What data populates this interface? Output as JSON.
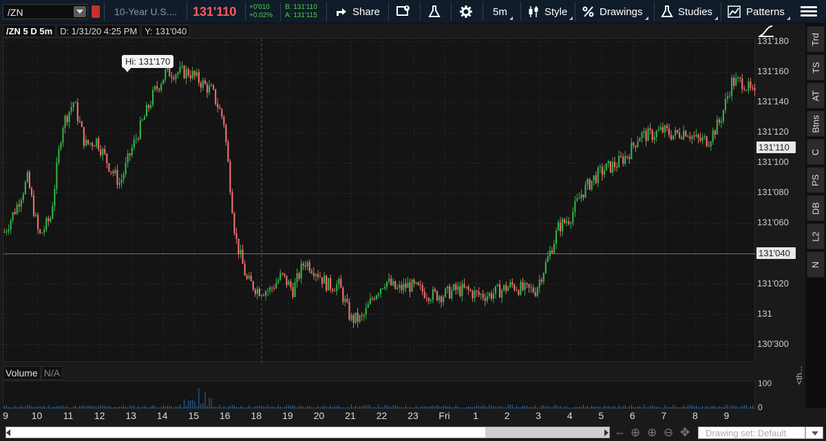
{
  "toolbar": {
    "symbol": "/ZN",
    "description": "10-Year U.S....",
    "last_price": "131'110",
    "net_change": "+0'010",
    "pct_change": "+0.02%",
    "bid": "B: 131'110",
    "ask": "A: 131'115",
    "share_label": "Share",
    "interval_label": "5m",
    "style_label": "Style",
    "drawings_label": "Drawings",
    "studies_label": "Studies",
    "patterns_label": "Patterns"
  },
  "chart_header": {
    "symbol_period": "/ZN 5 D 5m",
    "date_readout": "D: 1/31/20 4:25 PM",
    "price_readout": "Y: 131'040"
  },
  "hi_label": "Hi: 131'170",
  "price_axis": {
    "ticks": [
      "131'180",
      "131'160",
      "131'140",
      "131'120",
      "131'100",
      "131'080",
      "131'060",
      "131'040",
      "131'020",
      "131",
      "130'300"
    ],
    "last_box": "131'110",
    "crosshair_box": "131'040"
  },
  "side_tabs": [
    "Trd",
    "TS",
    "AT",
    "Btns",
    "C",
    "PS",
    "DB",
    "L2",
    "N"
  ],
  "volume": {
    "title": "Volume",
    "value": "N/A",
    "ticks": [
      "100",
      "0"
    ],
    "side_label": "<th..."
  },
  "time_axis": [
    "9",
    "10",
    "11",
    "12",
    "13",
    "14",
    "15",
    "16",
    "18",
    "19",
    "20",
    "21",
    "22",
    "23",
    "Fri",
    "1",
    "2",
    "3",
    "4",
    "5",
    "6",
    "7",
    "8",
    "9"
  ],
  "bottom": {
    "drawing_set": "Drawing set: Default"
  },
  "colors": {
    "up": "#33b44a",
    "down": "#f07070",
    "background": "#141414",
    "toolbar": "#111c2a",
    "last_price": "#ff5b5b"
  },
  "chart_data": {
    "type": "bar",
    "title": "/ZN 5 D 5m",
    "xlabel": "",
    "ylabel": "",
    "ylim": [
      130.9,
      131.57
    ],
    "x_labels": [
      "9",
      "10",
      "11",
      "12",
      "13",
      "14",
      "15",
      "16",
      "18",
      "19",
      "20",
      "21",
      "22",
      "23",
      "Fri",
      "1",
      "2",
      "3",
      "4",
      "5",
      "6",
      "7",
      "8",
      "9"
    ],
    "series": [
      {
        "values": [
          131.17,
          131.22,
          131.28,
          131.16,
          131.2,
          131.39,
          131.44,
          131.35,
          131.36,
          131.31,
          131.27,
          131.34,
          131.4,
          131.46,
          131.5,
          131.5,
          131.5,
          131.48,
          131.46,
          131.4,
          131.16,
          131.07,
          131.05,
          131.05,
          131.08,
          131.05,
          131.11,
          131.09,
          131.06,
          131.06,
          130.99,
          130.99,
          131.04,
          131.07,
          131.05,
          131.06,
          131.05,
          131.04,
          131.04,
          131.05,
          131.05,
          131.04,
          131.04,
          131.05,
          131.06,
          131.05,
          131.05,
          131.11,
          131.18,
          131.2,
          131.25,
          131.28,
          131.3,
          131.31,
          131.33,
          131.37,
          131.37,
          131.38,
          131.37,
          131.38,
          131.36,
          131.36,
          131.4,
          131.48,
          131.48,
          131.45
        ]
      }
    ]
  }
}
